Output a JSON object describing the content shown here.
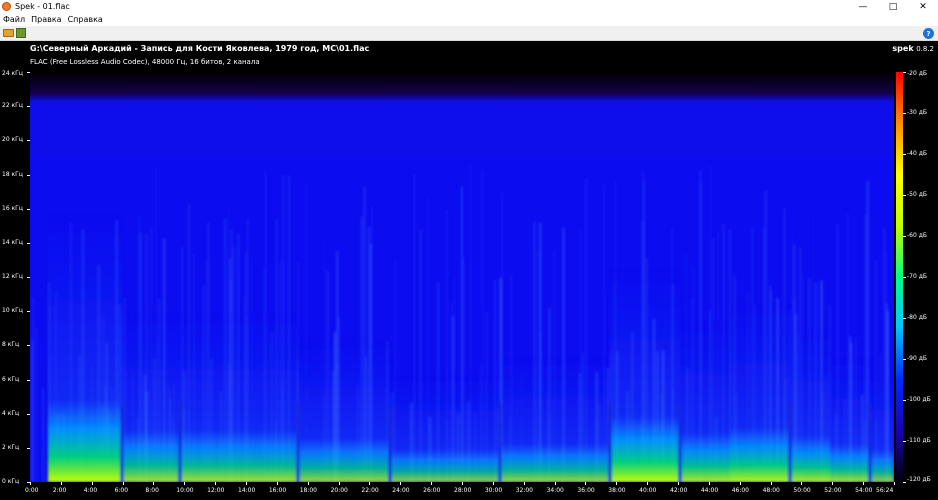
{
  "window": {
    "title": "Spek - 01.flac",
    "controls": {
      "minimize": "—",
      "maximize": "□",
      "close": "✕"
    }
  },
  "menu": [
    "Файл",
    "Правка",
    "Справка"
  ],
  "toolbar": {
    "icons": [
      "open-file-icon",
      "save-image-icon",
      "help-icon"
    ],
    "help_glyph": "?"
  },
  "file": {
    "path": "G:\\Северный Аркадий - Запись для Кости Яковлева, 1979 год, МС\\01.flac",
    "info": "FLAC (Free Lossless Audio Codec), 48000 Гц, 16 битов, 2 канала"
  },
  "brand": {
    "name": "spek",
    "version": "0.8.2"
  },
  "freq_labels": [
    "24 кГц",
    "22 кГц",
    "20 кГц",
    "18 кГц",
    "16 кГц",
    "14 кГц",
    "12 кГц",
    "10 кГц",
    "8 кГц",
    "6 кГц",
    "4 кГц",
    "2 кГц",
    "0 кГц"
  ],
  "time_labels": [
    "0:00",
    "2:00",
    "4:00",
    "6:00",
    "8:00",
    "10:00",
    "12:00",
    "14:00",
    "16:00",
    "18:00",
    "20:00",
    "22:00",
    "24:00",
    "26:00",
    "28:00",
    "30:00",
    "32:00",
    "34:00",
    "36:00",
    "38:00",
    "40:00",
    "42:00",
    "44:00",
    "46:00",
    "48:00",
    "50:00",
    "52:00",
    "54:00",
    "56:24"
  ],
  "db_labels": [
    "-20 дБ",
    "-30 дБ",
    "-40 дБ",
    "-50 дБ",
    "-60 дБ",
    "-70 дБ",
    "-80 дБ",
    "-90 дБ",
    "-100 дБ",
    "-110 дБ",
    "-120 дБ"
  ],
  "colors": {
    "background": "#000000",
    "spectrum_base": "#0c0cf0",
    "accent": "#1d73d4"
  }
}
